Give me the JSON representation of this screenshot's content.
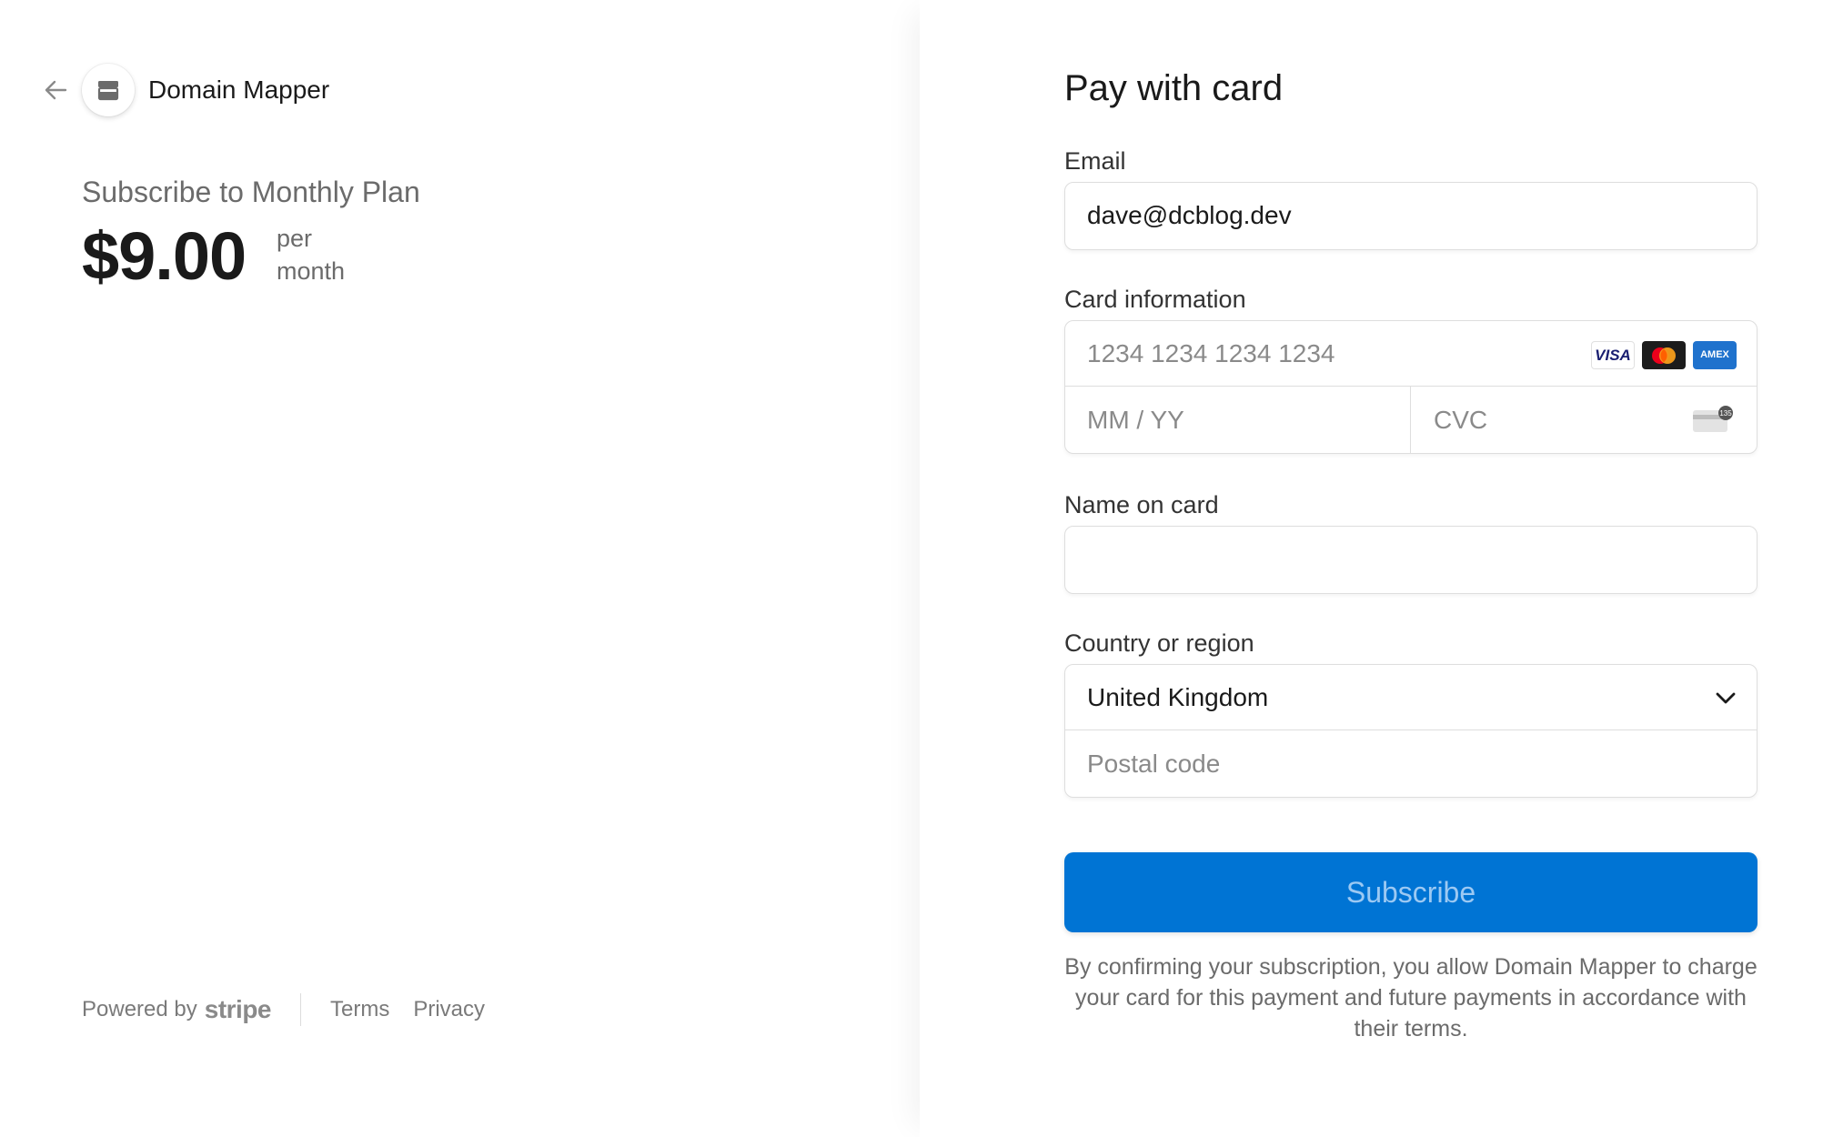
{
  "header": {
    "merchant_name": "Domain Mapper"
  },
  "summary": {
    "product_title": "Subscribe to Monthly Plan",
    "price": "$9.00",
    "period_line1": "per",
    "period_line2": "month"
  },
  "footer": {
    "powered_by": "Powered by",
    "stripe": "stripe",
    "terms": "Terms",
    "privacy": "Privacy"
  },
  "form": {
    "title": "Pay with card",
    "email_label": "Email",
    "email_value": "dave@dcblog.dev",
    "card_label": "Card information",
    "card_number_placeholder": "1234 1234 1234 1234",
    "expiry_placeholder": "MM / YY",
    "cvc_placeholder": "CVC",
    "card_brands": [
      "VISA",
      "mastercard",
      "AMEX"
    ],
    "name_label": "Name on card",
    "name_value": "",
    "country_label": "Country or region",
    "country_value": "United Kingdom",
    "postal_placeholder": "Postal code",
    "subscribe_label": "Subscribe",
    "terms_text": "By confirming your subscription, you allow Domain Mapper to charge your card for this payment and future payments in accordance with their terms."
  },
  "colors": {
    "accent": "#0074d4",
    "button_text": "#9cc9f3"
  }
}
